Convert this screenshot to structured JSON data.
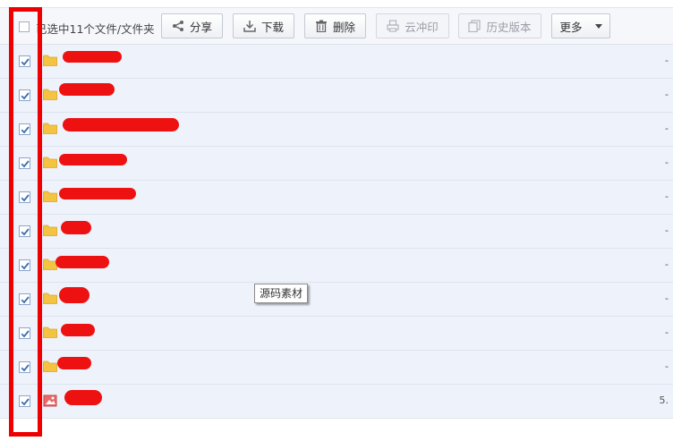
{
  "toolbar": {
    "selection_text": "已选中11个文件/文件夹",
    "buttons": {
      "share": "分享",
      "download": "下载",
      "delete": "删除",
      "cloud_print": "云冲印",
      "history": "历史版本",
      "more": "更多"
    }
  },
  "files": [
    {
      "name": "",
      "type": "folder",
      "size": "-",
      "checked": true
    },
    {
      "name": "",
      "type": "folder",
      "size": "-",
      "checked": true
    },
    {
      "name": "",
      "type": "folder",
      "size": "-",
      "checked": true
    },
    {
      "name": "",
      "type": "folder",
      "size": "-",
      "checked": true
    },
    {
      "name": "",
      "type": "folder",
      "size": "-",
      "checked": true
    },
    {
      "name": "",
      "type": "folder",
      "size": "-",
      "checked": true
    },
    {
      "name": "",
      "type": "folder",
      "size": "-",
      "checked": true
    },
    {
      "name": "",
      "type": "folder",
      "size": "-",
      "checked": true
    },
    {
      "name": "",
      "type": "folder",
      "size": "-",
      "checked": true
    },
    {
      "name": "",
      "type": "folder",
      "size": "-",
      "checked": true
    },
    {
      "name": "",
      "type": "image",
      "size": "5.",
      "checked": true
    }
  ],
  "tooltip": "源码素材",
  "colors": {
    "highlight_box": "#ee0000",
    "redaction": "#ee1111",
    "folder": "#f5c342",
    "row_background": "#eef2fb",
    "checkmark": "#3a6fb0"
  }
}
